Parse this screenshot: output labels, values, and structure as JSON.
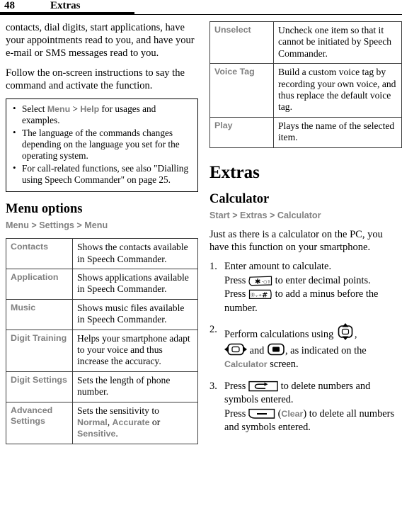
{
  "header": {
    "folio": "48",
    "title": "Extras"
  },
  "left_column": {
    "paragraphs": [
      "contacts, dial digits, start applications, have your appointments read to you, and have your e-mail or SMS messages read to you.",
      "Follow the on-screen instructions to say the command and activate the function."
    ],
    "note_box": {
      "items": [
        {
          "pre": "Select ",
          "ui1": "Menu",
          "mid": " > ",
          "ui2": "Help",
          "post": " for usages and examples."
        },
        {
          "text": "The language of the commands changes depending on the language you set for the operating system."
        },
        {
          "text": "For call-related functions, see also \"Dialling using Speech Commander\" on page 25."
        }
      ]
    },
    "section_heading": "Menu options",
    "breadcrumb": "Menu > Settings > Menu",
    "table": {
      "rows": [
        {
          "key": "Contacts",
          "value": "Shows the contacts available in Speech Commander."
        },
        {
          "key": "Application",
          "value": "Shows applications available in Speech Commander."
        },
        {
          "key": "Music",
          "value": "Shows music files available in Speech Commander."
        },
        {
          "key": "Digit Training",
          "value": "Helps your smartphone adapt to your voice and thus increase the accuracy."
        },
        {
          "key": "Digit Settings",
          "value": "Sets the length of phone number."
        },
        {
          "key": "Advanced Settings",
          "value_pre": "Sets the sensitivity to ",
          "value_ui1": "Normal",
          "value_sep1": ", ",
          "value_ui2": "Accurate",
          "value_sep2": " or ",
          "value_ui3": "Sensitive",
          "value_post": "."
        }
      ]
    }
  },
  "right_column": {
    "table": {
      "rows": [
        {
          "key": "Unselect",
          "value": "Uncheck one item so that it cannot be initiated by Speech Commander."
        },
        {
          "key": "Voice Tag",
          "value": "Build a custom voice tag by recording your own voice, and thus replace the default voice tag."
        },
        {
          "key": "Play",
          "value": "Plays the name of the selected item."
        }
      ]
    },
    "chapter_heading": "Extras",
    "section_heading": "Calculator",
    "breadcrumb": "Start > Extras > Calculator",
    "intro": "Just as there is a calculator on the PC, you have this function on your smartphone.",
    "steps": [
      {
        "lines": [
          {
            "text": "Enter amount to calculate."
          },
          {
            "pre": "Press ",
            "icon": "star-key-icon",
            "post": " to enter decimal points."
          },
          {
            "pre": "Press ",
            "icon": "hash-key-icon",
            "post": " to add a minus before the number."
          }
        ]
      },
      {
        "lines": [
          {
            "pre": "Perform calculations using ",
            "icon": "updown-nav-key-icon",
            "post": ","
          },
          {
            "icon": "leftright-nav-key-icon",
            "mid": " and ",
            "icon2": "select-key-icon",
            "post": ", as indicated on the"
          },
          {
            "ui": "Calculator",
            "post": " screen."
          }
        ]
      },
      {
        "lines": [
          {
            "pre": "Press ",
            "icon": "back-key-icon",
            "post": " to delete numbers and symbols entered."
          },
          {
            "pre": "Press ",
            "icon": "clear-key-icon",
            "mid": " (",
            "ui": "Clear",
            "post": ") to delete all numbers and symbols entered."
          }
        ]
      }
    ]
  },
  "colors": {
    "ui_term_gray": "#808080",
    "text_black": "#000000",
    "table_border": "#3c3c3c"
  }
}
